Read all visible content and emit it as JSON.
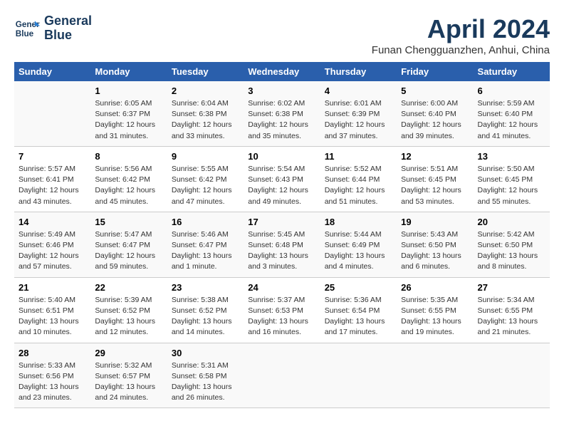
{
  "header": {
    "logo_line1": "General",
    "logo_line2": "Blue",
    "title": "April 2024",
    "subtitle": "Funan Chengguanzhen, Anhui, China"
  },
  "weekdays": [
    "Sunday",
    "Monday",
    "Tuesday",
    "Wednesday",
    "Thursday",
    "Friday",
    "Saturday"
  ],
  "weeks": [
    [
      {
        "day": "",
        "info": ""
      },
      {
        "day": "1",
        "info": "Sunrise: 6:05 AM\nSunset: 6:37 PM\nDaylight: 12 hours\nand 31 minutes."
      },
      {
        "day": "2",
        "info": "Sunrise: 6:04 AM\nSunset: 6:38 PM\nDaylight: 12 hours\nand 33 minutes."
      },
      {
        "day": "3",
        "info": "Sunrise: 6:02 AM\nSunset: 6:38 PM\nDaylight: 12 hours\nand 35 minutes."
      },
      {
        "day": "4",
        "info": "Sunrise: 6:01 AM\nSunset: 6:39 PM\nDaylight: 12 hours\nand 37 minutes."
      },
      {
        "day": "5",
        "info": "Sunrise: 6:00 AM\nSunset: 6:40 PM\nDaylight: 12 hours\nand 39 minutes."
      },
      {
        "day": "6",
        "info": "Sunrise: 5:59 AM\nSunset: 6:40 PM\nDaylight: 12 hours\nand 41 minutes."
      }
    ],
    [
      {
        "day": "7",
        "info": "Sunrise: 5:57 AM\nSunset: 6:41 PM\nDaylight: 12 hours\nand 43 minutes."
      },
      {
        "day": "8",
        "info": "Sunrise: 5:56 AM\nSunset: 6:42 PM\nDaylight: 12 hours\nand 45 minutes."
      },
      {
        "day": "9",
        "info": "Sunrise: 5:55 AM\nSunset: 6:42 PM\nDaylight: 12 hours\nand 47 minutes."
      },
      {
        "day": "10",
        "info": "Sunrise: 5:54 AM\nSunset: 6:43 PM\nDaylight: 12 hours\nand 49 minutes."
      },
      {
        "day": "11",
        "info": "Sunrise: 5:52 AM\nSunset: 6:44 PM\nDaylight: 12 hours\nand 51 minutes."
      },
      {
        "day": "12",
        "info": "Sunrise: 5:51 AM\nSunset: 6:45 PM\nDaylight: 12 hours\nand 53 minutes."
      },
      {
        "day": "13",
        "info": "Sunrise: 5:50 AM\nSunset: 6:45 PM\nDaylight: 12 hours\nand 55 minutes."
      }
    ],
    [
      {
        "day": "14",
        "info": "Sunrise: 5:49 AM\nSunset: 6:46 PM\nDaylight: 12 hours\nand 57 minutes."
      },
      {
        "day": "15",
        "info": "Sunrise: 5:47 AM\nSunset: 6:47 PM\nDaylight: 12 hours\nand 59 minutes."
      },
      {
        "day": "16",
        "info": "Sunrise: 5:46 AM\nSunset: 6:47 PM\nDaylight: 13 hours\nand 1 minute."
      },
      {
        "day": "17",
        "info": "Sunrise: 5:45 AM\nSunset: 6:48 PM\nDaylight: 13 hours\nand 3 minutes."
      },
      {
        "day": "18",
        "info": "Sunrise: 5:44 AM\nSunset: 6:49 PM\nDaylight: 13 hours\nand 4 minutes."
      },
      {
        "day": "19",
        "info": "Sunrise: 5:43 AM\nSunset: 6:50 PM\nDaylight: 13 hours\nand 6 minutes."
      },
      {
        "day": "20",
        "info": "Sunrise: 5:42 AM\nSunset: 6:50 PM\nDaylight: 13 hours\nand 8 minutes."
      }
    ],
    [
      {
        "day": "21",
        "info": "Sunrise: 5:40 AM\nSunset: 6:51 PM\nDaylight: 13 hours\nand 10 minutes."
      },
      {
        "day": "22",
        "info": "Sunrise: 5:39 AM\nSunset: 6:52 PM\nDaylight: 13 hours\nand 12 minutes."
      },
      {
        "day": "23",
        "info": "Sunrise: 5:38 AM\nSunset: 6:52 PM\nDaylight: 13 hours\nand 14 minutes."
      },
      {
        "day": "24",
        "info": "Sunrise: 5:37 AM\nSunset: 6:53 PM\nDaylight: 13 hours\nand 16 minutes."
      },
      {
        "day": "25",
        "info": "Sunrise: 5:36 AM\nSunset: 6:54 PM\nDaylight: 13 hours\nand 17 minutes."
      },
      {
        "day": "26",
        "info": "Sunrise: 5:35 AM\nSunset: 6:55 PM\nDaylight: 13 hours\nand 19 minutes."
      },
      {
        "day": "27",
        "info": "Sunrise: 5:34 AM\nSunset: 6:55 PM\nDaylight: 13 hours\nand 21 minutes."
      }
    ],
    [
      {
        "day": "28",
        "info": "Sunrise: 5:33 AM\nSunset: 6:56 PM\nDaylight: 13 hours\nand 23 minutes."
      },
      {
        "day": "29",
        "info": "Sunrise: 5:32 AM\nSunset: 6:57 PM\nDaylight: 13 hours\nand 24 minutes."
      },
      {
        "day": "30",
        "info": "Sunrise: 5:31 AM\nSunset: 6:58 PM\nDaylight: 13 hours\nand 26 minutes."
      },
      {
        "day": "",
        "info": ""
      },
      {
        "day": "",
        "info": ""
      },
      {
        "day": "",
        "info": ""
      },
      {
        "day": "",
        "info": ""
      }
    ]
  ]
}
